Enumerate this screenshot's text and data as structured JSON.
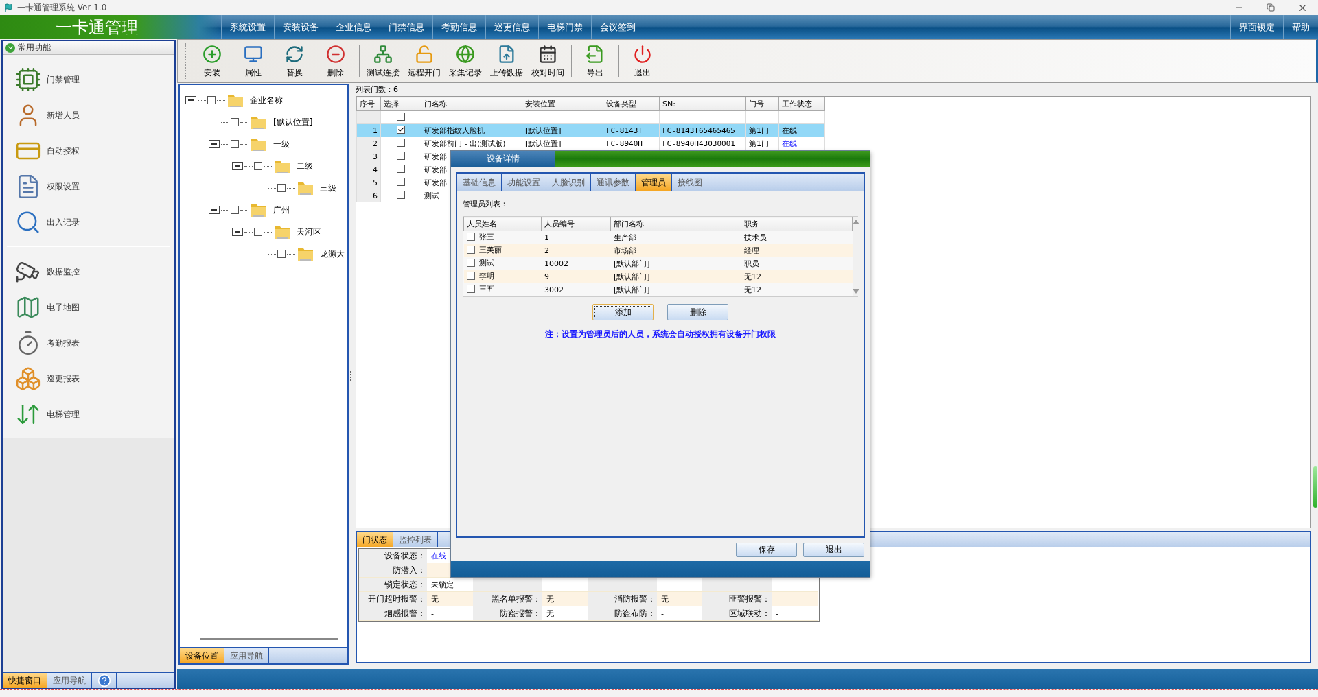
{
  "window": {
    "title": "一卡通管理系统 Ver 1.0"
  },
  "header": {
    "brand": "一卡通管理",
    "menu": [
      "系统设置",
      "安装设备",
      "企业信息",
      "门禁信息",
      "考勤信息",
      "巡更信息",
      "电梯门禁",
      "会议签到"
    ],
    "right_menu": [
      "界面锁定",
      "帮助"
    ]
  },
  "sidebar": {
    "section": "常用功能",
    "groups": [
      [
        "门禁管理",
        "新增人员",
        "自动授权",
        "权限设置",
        "出入记录"
      ],
      [
        "数据监控",
        "电子地图",
        "考勤报表",
        "巡更报表",
        "电梯管理"
      ]
    ],
    "tabs": [
      {
        "label": "快捷窗口",
        "selected": true
      },
      {
        "label": "应用导航",
        "selected": false
      }
    ]
  },
  "toolbar": {
    "groups": [
      [
        "安装",
        "属性",
        "替换",
        "删除"
      ],
      [
        "测试连接",
        "远程开门",
        "采集记录",
        "上传数据",
        "校对时间"
      ],
      [
        "导出"
      ],
      [
        "退出"
      ]
    ]
  },
  "tree": {
    "nodes": [
      {
        "label": "企业名称",
        "checked": false,
        "expanded": true,
        "children": [
          {
            "label": "[默认位置]",
            "checked": false
          },
          {
            "label": "一级",
            "checked": false,
            "expanded": true,
            "children": [
              {
                "label": "二级",
                "checked": false,
                "expanded": true,
                "children": [
                  {
                    "label": "三级",
                    "checked": false
                  }
                ]
              }
            ]
          },
          {
            "label": "广州",
            "checked": false,
            "expanded": true,
            "children": [
              {
                "label": "天河区",
                "checked": false,
                "expanded": true,
                "children": [
                  {
                    "label": "龙源大",
                    "checked": false
                  }
                ]
              }
            ]
          }
        ]
      }
    ],
    "tabs": [
      {
        "label": "设备位置",
        "selected": true
      },
      {
        "label": "应用导航",
        "selected": false
      }
    ]
  },
  "door_table": {
    "count_label": "列表门数：6",
    "columns": [
      "序号",
      "选择",
      "门名称",
      "安装位置",
      "设备类型",
      "SN:",
      "门号",
      "工作状态"
    ],
    "select_all": {
      "checked": false
    },
    "rows": [
      {
        "index": "1",
        "checked": true,
        "selected": true,
        "name": "研发部指纹人脸机",
        "location": "[默认位置]",
        "type": "FC-8143T",
        "sn": "FC-8143T65465465",
        "door": "第1门",
        "status": "在线"
      },
      {
        "index": "2",
        "checked": false,
        "selected": false,
        "name": "研发部前门 - 出(测试版)",
        "location": "[默认位置]",
        "type": "FC-8940H",
        "sn": "FC-8940H43030001",
        "door": "第1门",
        "status": "在线"
      },
      {
        "index": "3",
        "checked": false,
        "selected": false,
        "name": "研发部"
      },
      {
        "index": "4",
        "checked": false,
        "selected": false,
        "name": "研发部"
      },
      {
        "index": "5",
        "checked": false,
        "selected": false,
        "name": "研发部"
      },
      {
        "index": "6",
        "checked": false,
        "selected": false,
        "name": "测试"
      }
    ]
  },
  "status_panel": {
    "tabs": [
      {
        "label": "门状态",
        "selected": true
      },
      {
        "label": "监控列表",
        "selected": false
      }
    ],
    "rows": [
      [
        {
          "label": "设备状态：",
          "value": "在线",
          "highlight": true
        }
      ],
      [
        {
          "label": "防潜入：",
          "value": "-",
          "highlight": false
        }
      ],
      [
        {
          "label": "锁定状态：",
          "value": "未锁定",
          "highlight": false
        }
      ],
      [
        {
          "label": "开门超时报警：",
          "value": "无",
          "highlight": false
        },
        {
          "label": "黑名单报警：",
          "value": "无",
          "highlight": false
        },
        {
          "label": "消防报警：",
          "value": "无",
          "highlight": false
        },
        {
          "label": "匪警报警：",
          "value": "-",
          "highlight": false
        }
      ],
      [
        {
          "label": "烟感报警：",
          "value": "-",
          "highlight": false
        },
        {
          "label": "防盗报警：",
          "value": "无",
          "highlight": false
        },
        {
          "label": "防盗布防：",
          "value": "-",
          "highlight": false
        },
        {
          "label": "区域联动：",
          "value": "-",
          "highlight": false
        }
      ]
    ]
  },
  "dialog": {
    "title": "设备详情",
    "tabs": [
      {
        "label": "基础信息",
        "selected": false
      },
      {
        "label": "功能设置",
        "selected": false
      },
      {
        "label": "人脸识别",
        "selected": false
      },
      {
        "label": "通讯参数",
        "selected": false
      },
      {
        "label": "管理员",
        "selected": true
      },
      {
        "label": "接线图",
        "selected": false
      }
    ],
    "list_label": "管理员列表：",
    "columns": [
      "人员姓名",
      "人员编号",
      "部门名称",
      "职务"
    ],
    "rows": [
      {
        "checked": false,
        "name": "张三",
        "id": "1",
        "dept": "生产部",
        "role": "技术员"
      },
      {
        "checked": false,
        "name": "王美丽",
        "id": "2",
        "dept": "市场部",
        "role": "经理"
      },
      {
        "checked": false,
        "name": "测试",
        "id": "10002",
        "dept": "[默认部门]",
        "role": "职员"
      },
      {
        "checked": false,
        "name": "李明",
        "id": "9",
        "dept": "[默认部门]",
        "role": "无12"
      },
      {
        "checked": false,
        "name": "王五",
        "id": "3002",
        "dept": "[默认部门]",
        "role": "无12"
      }
    ],
    "buttons": [
      {
        "label": "添加",
        "focused": true
      },
      {
        "label": "删除",
        "focused": false
      }
    ],
    "note": "注：设置为管理员后的人员，系统会自动授权拥有设备开门权限",
    "footer_buttons": [
      {
        "label": "保存",
        "focused": false
      },
      {
        "label": "退出",
        "focused": false
      }
    ]
  }
}
